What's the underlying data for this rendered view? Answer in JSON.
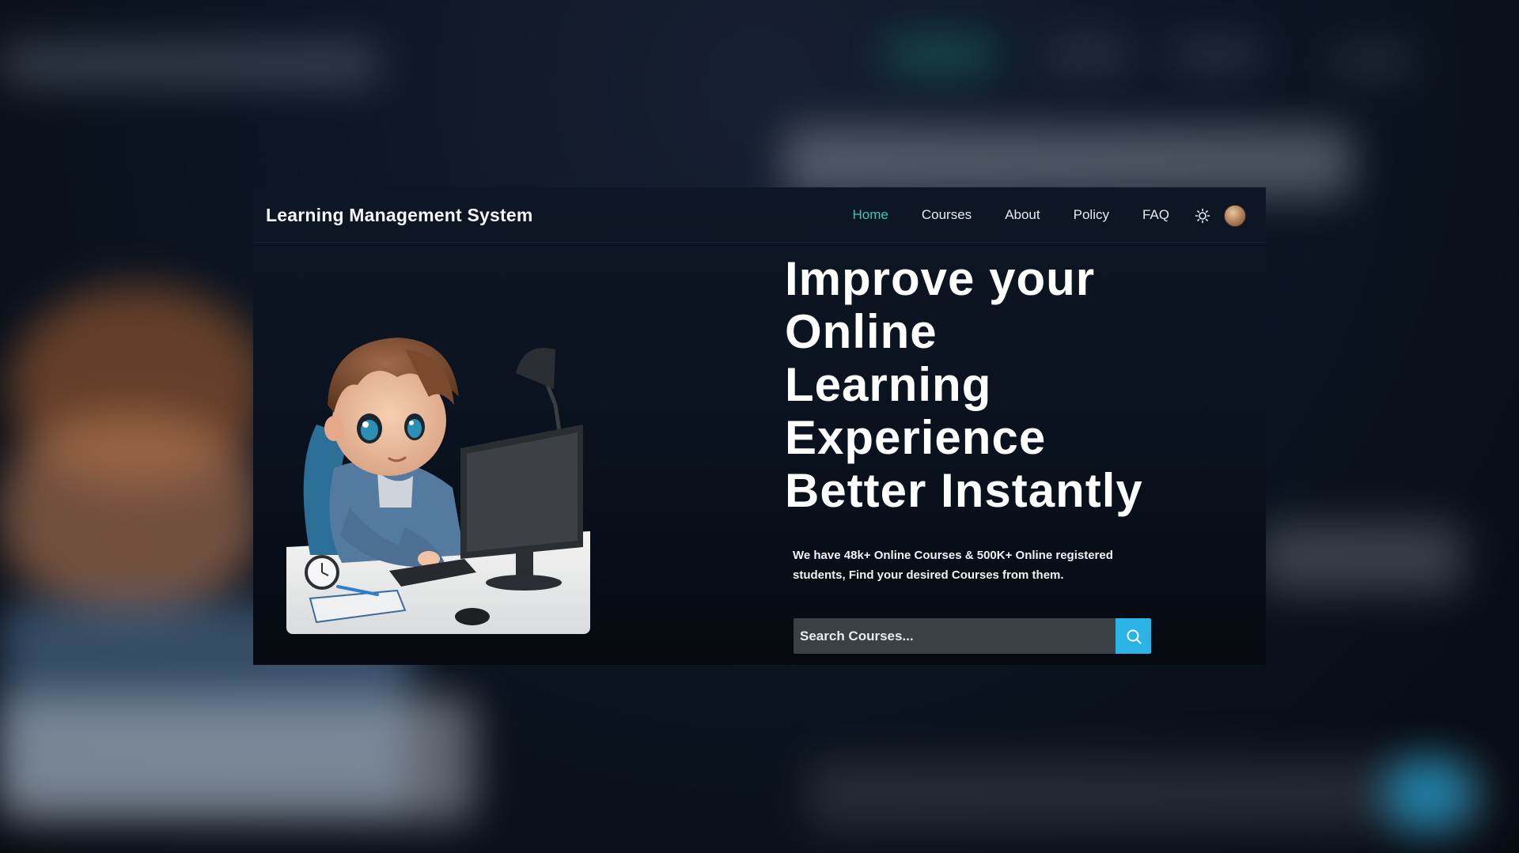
{
  "brand": {
    "title": "Learning Management System"
  },
  "nav": {
    "items": [
      {
        "label": "Home",
        "active": true
      },
      {
        "label": "Courses",
        "active": false
      },
      {
        "label": "About",
        "active": false
      },
      {
        "label": "Policy",
        "active": false
      },
      {
        "label": "FAQ",
        "active": false
      }
    ],
    "theme_icon": "sun-icon",
    "avatar_icon": "avatar"
  },
  "hero": {
    "title_lines": [
      "Improve your",
      "Online",
      "Learning",
      "Experience",
      "Better Instantly"
    ],
    "description": "We have 48k+ Online Courses & 500K+ Online registered students, Find your desired Courses from them.",
    "search_placeholder": "Search Courses...",
    "search_icon": "search-icon"
  },
  "colors": {
    "accent": "#38c9b0",
    "search_button": "#2bb3e6",
    "background": "#0a121f"
  }
}
